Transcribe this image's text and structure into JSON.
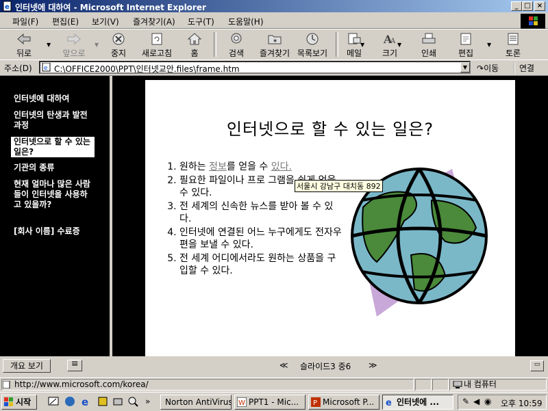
{
  "window": {
    "title": "인터넷에 대하여 - Microsoft Internet Explorer",
    "controls": [
      "_",
      "□",
      "×"
    ]
  },
  "menu": [
    "파일(F)",
    "편집(E)",
    "보기(V)",
    "즐겨찾기(A)",
    "도구(T)",
    "도움말(H)"
  ],
  "toolbar": {
    "back": "뒤로",
    "forward": "앞으로",
    "stop": "중지",
    "refresh": "새로고침",
    "home": "홈",
    "search": "검색",
    "favorites": "즐겨찾기",
    "history": "목록보기",
    "mail": "메일",
    "size": "크기",
    "print": "인쇄",
    "edit": "편집",
    "discuss": "토론"
  },
  "address": {
    "label": "주소(D)",
    "value": "C:\\OFFICE2000\\PPT\\인터넷교안.files\\frame.htm",
    "go": "이동",
    "links": "연결"
  },
  "outline": {
    "items": [
      {
        "label": "인터넷에 대하여"
      },
      {
        "label": "인터넷의 탄생과 발전과정"
      },
      {
        "label": "인터넷으로 할 수 있는 일은?",
        "selected": true
      },
      {
        "label": "기관의 종류"
      },
      {
        "label": "현재 얼마나 많은 사람들이 인터넷을 사용하고 있을까?"
      },
      {
        "label": "[회사 이름] 수료증"
      }
    ],
    "view_button": "개요 보기"
  },
  "slide": {
    "title": "인터넷으로 할 수 있는 일은?",
    "bullets": [
      {
        "pre": "원하는 ",
        "link1": "정보",
        "mid": "를 얻을 수 ",
        "link2": "있다."
      },
      {
        "text": "필요한 파일이나 프로 그램을 쉽게 얻을 수 있다."
      },
      {
        "text": "전 세계의 신속한 뉴스를 받아 볼 수 있다."
      },
      {
        "text": "인터넷에 연결된 어느 누구에게도 전자우편을 보낼 수 있다."
      },
      {
        "text": "전 세계 어디에서라도 원하는 상품을 구입할 수 있다."
      }
    ],
    "tooltip": "서울시 강남구 대치동 892",
    "nav": {
      "prev": "≪",
      "counter": "슬라이드3 중6",
      "next": "≫"
    }
  },
  "status": {
    "text": "http://www.microsoft.com/korea/",
    "zone": "내 컴퓨터"
  },
  "taskbar": {
    "start": "시작",
    "tasks": [
      {
        "label": "Norton AntiVirus",
        "active": false
      },
      {
        "label": "PPT1 - Mic...",
        "active": false
      },
      {
        "label": "Microsoft P...",
        "active": false
      },
      {
        "label": "인터넷에 ...",
        "active": true
      }
    ],
    "clock": "오후 10:59"
  },
  "colors": {
    "titlebar": "#0a246a",
    "chrome": "#d4d0c8",
    "slide_background": "#ffffff",
    "frame_background": "#000000"
  }
}
